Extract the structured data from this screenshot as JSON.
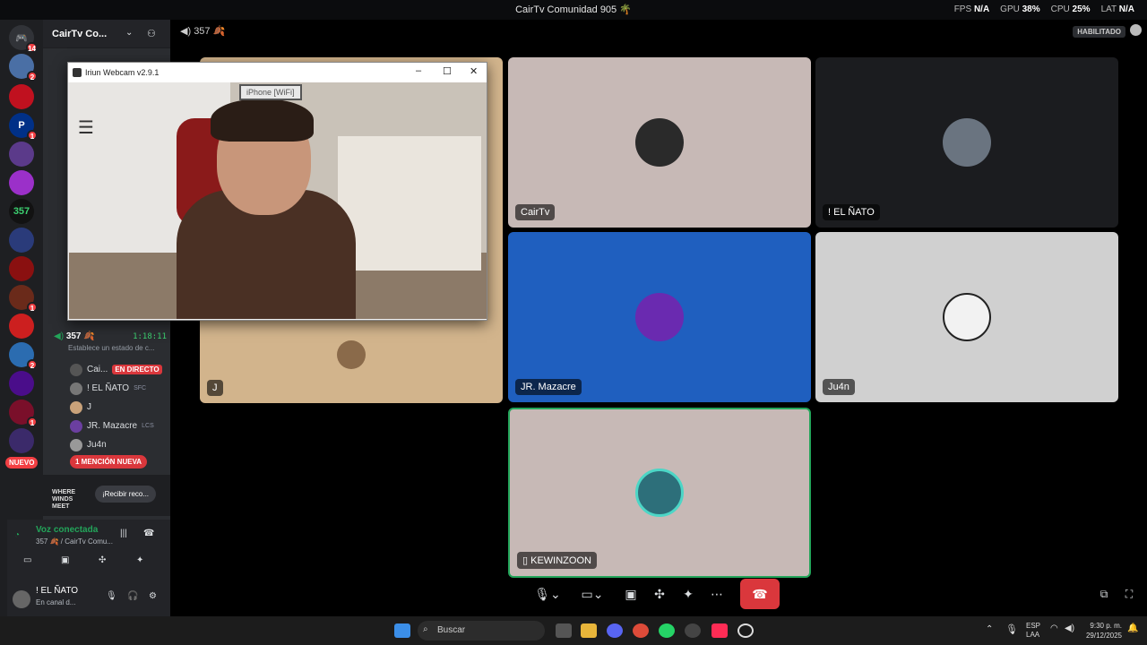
{
  "app_title": "CairTv Comunidad 905 🌴",
  "stats": {
    "fps_label": "FPS",
    "fps": "N/A",
    "gpu_label": "GPU",
    "gpu": "38%",
    "cpu_label": "CPU",
    "cpu": "25%",
    "lat_label": "LAT",
    "lat": "N/A",
    "enabled": "HABILITADO"
  },
  "server": {
    "name": "CairTv Co...",
    "notif_badges": [
      "14",
      "2",
      "1",
      "1",
      "2",
      "1",
      "2"
    ],
    "new_label": "NUEVO",
    "gaming_tag": "357"
  },
  "channel": {
    "name": "357 🍂",
    "timer": "1:18:11",
    "status_placeholder": "Establece un estado de c...",
    "members": [
      {
        "name": "Cai...",
        "badge": "EN DIRECTO"
      },
      {
        "name": "! EL ÑATO",
        "tag": "SFC"
      },
      {
        "name": "J"
      },
      {
        "name": "JR. Mazacre",
        "tag": "LCS"
      },
      {
        "name": "Ju4n"
      }
    ],
    "mention": "1 MENCIÓN NUEVA"
  },
  "promo": {
    "label": "¡Recibir reco...",
    "brand": "WHERE WINDS MEET"
  },
  "voice": {
    "status": "Voz conectada",
    "location": "357 🍂 / CairTv Comu..."
  },
  "user": {
    "name": "! EL ÑATO",
    "status": "En canal d..."
  },
  "header": {
    "channel": "357 🍂"
  },
  "webcam_window": {
    "title": "Iriun Webcam v2.9.1",
    "device": "iPhone [WiFi]"
  },
  "tiles": [
    {
      "label": "CairTv"
    },
    {
      "label": "! EL ÑATO"
    },
    {
      "label": "J"
    },
    {
      "label": "JR. Mazacre"
    },
    {
      "label": "Ju4n"
    },
    {
      "label": "KEWINZOON"
    }
  ],
  "taskbar": {
    "search": "Buscar",
    "lang1": "ESP",
    "lang2": "LAA",
    "time": "9:30 p. m.",
    "date": "29/12/2025"
  },
  "colors": {
    "blue_tile": "#1f5fbf",
    "beige_tile": "#d2b48c",
    "pink_tile": "#c7b9b6",
    "dark_tile": "#1b1c1f",
    "light_tile": "#d0d0d0",
    "green": "#23a55a",
    "red": "#da373c"
  }
}
